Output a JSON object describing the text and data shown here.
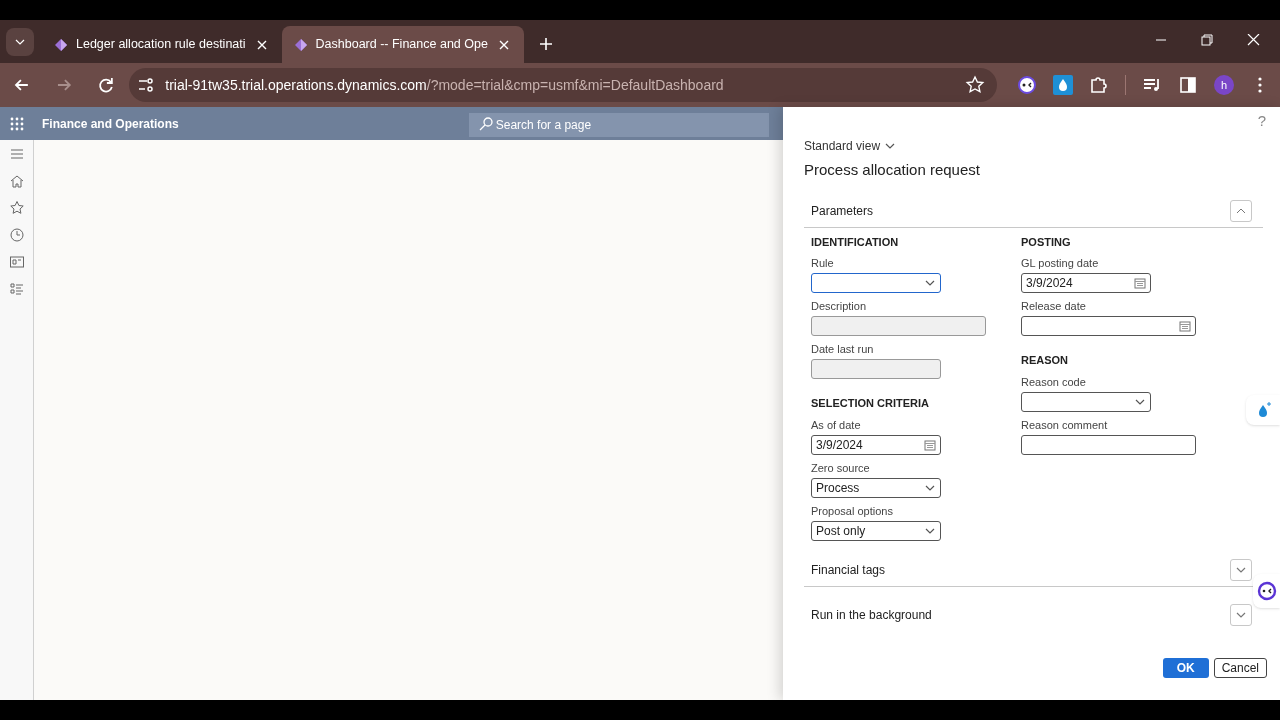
{
  "browser": {
    "tabs": [
      {
        "title": "Ledger allocation rule destinati",
        "selected": false
      },
      {
        "title": "Dashboard -- Finance and Ope",
        "selected": true
      }
    ],
    "url": {
      "host": "trial-91tw35.trial.operations.dynamics.com",
      "path": "/?mode=trial&cmp=usmf&mi=DefaultDashboard"
    },
    "profile_initial": "h"
  },
  "app": {
    "title": "Finance and Operations",
    "search": {
      "placeholder": "Search for a page"
    }
  },
  "dialog": {
    "help": "?",
    "view": "Standard view",
    "title": "Process allocation request",
    "sections": [
      {
        "title": "Parameters",
        "expanded": true,
        "columns": [
          [
            {
              "heading": "IDENTIFICATION",
              "fields": [
                {
                  "label": "Rule",
                  "kind": "combo",
                  "focused": true
                },
                {
                  "label": "Description",
                  "kind": "readonly",
                  "focused": false
                },
                {
                  "label": "Date last run",
                  "kind": "readonly",
                  "focused": false
                }
              ]
            },
            {
              "heading": "SELECTION CRITERIA",
              "fields": [
                {
                  "label": "As of date",
                  "kind": "date",
                  "value": "3/9/2024",
                  "focused": false
                },
                {
                  "label": "Zero source",
                  "kind": "combo",
                  "value": "Process",
                  "focused": false
                },
                {
                  "label": "Proposal options",
                  "kind": "combo",
                  "value": "Post only",
                  "focused": false
                }
              ]
            }
          ],
          [
            {
              "heading": "POSTING",
              "fields": [
                {
                  "label": "GL posting date",
                  "kind": "date",
                  "value": "3/9/2024",
                  "focused": false
                },
                {
                  "label": "Release date",
                  "kind": "date",
                  "focused": false
                }
              ]
            },
            {
              "heading": "REASON",
              "fields": [
                {
                  "label": "Reason code",
                  "kind": "combo",
                  "focused": false
                },
                {
                  "label": "Reason comment",
                  "kind": "text",
                  "focused": false
                }
              ]
            }
          ]
        ]
      },
      {
        "title": "Financial tags",
        "expanded": false
      },
      {
        "title": "Run in the background",
        "expanded": false
      }
    ],
    "buttons": [
      {
        "label": "OK",
        "primary": true
      },
      {
        "label": "Cancel",
        "primary": false
      }
    ]
  }
}
